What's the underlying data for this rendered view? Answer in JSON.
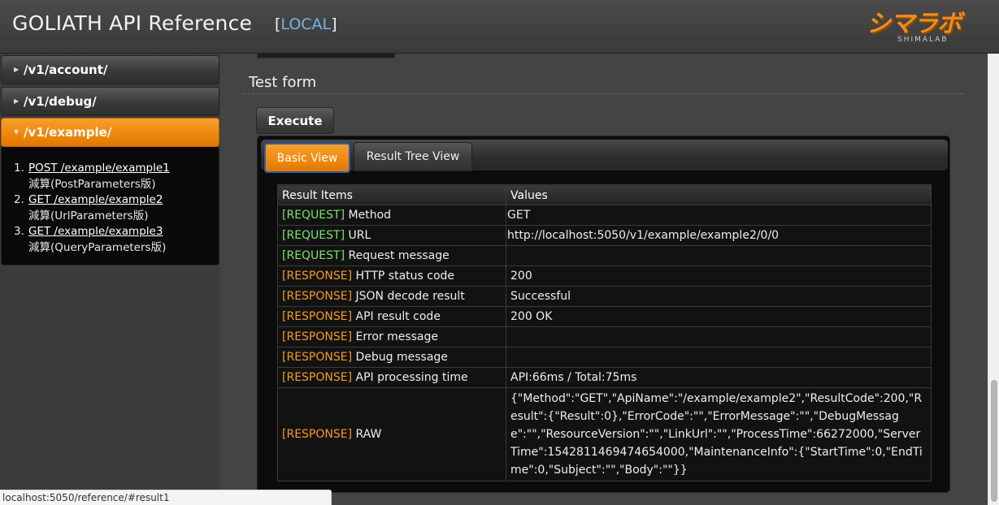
{
  "header": {
    "title": "GOLIATH API Reference",
    "env_open": "[",
    "env_name": "LOCAL",
    "env_close": "]",
    "logo_text": "シマラボ",
    "logo_sub": "SHIMALAB"
  },
  "sidebar": {
    "items": [
      {
        "label": "/v1/account/"
      },
      {
        "label": "/v1/debug/"
      },
      {
        "label": "/v1/example/"
      }
    ],
    "example_links": [
      {
        "num": "1.",
        "link": "POST /example/example1",
        "desc": "減算(PostParameters版)"
      },
      {
        "num": "2.",
        "link": "GET /example/example2",
        "desc": "減算(UrlParameters版)"
      },
      {
        "num": "3.",
        "link": "GET /example/example3",
        "desc": "減算(QueryParameters版)"
      }
    ]
  },
  "main": {
    "section_title": "Test form",
    "execute_label": "Execute",
    "tabs": [
      {
        "label": "Basic View"
      },
      {
        "label": "Result Tree View"
      }
    ],
    "table": {
      "headers": [
        "Result Items",
        "Values"
      ],
      "rows": [
        {
          "tag": "[REQUEST]",
          "item": " Method",
          "value": "GET"
        },
        {
          "tag": "[REQUEST]",
          "item": " URL",
          "value": "http://localhost:5050/v1/example/example2/0/0"
        },
        {
          "tag": "[REQUEST]",
          "item": " Request message",
          "value": ""
        },
        {
          "tag": "[RESPONSE]",
          "item": " HTTP status code",
          "value": "200"
        },
        {
          "tag": "[RESPONSE]",
          "item": " JSON decode result",
          "value": "Successful"
        },
        {
          "tag": "[RESPONSE]",
          "item": " API result code",
          "value": "200 OK"
        },
        {
          "tag": "[RESPONSE]",
          "item": " Error message",
          "value": ""
        },
        {
          "tag": "[RESPONSE]",
          "item": " Debug message",
          "value": ""
        },
        {
          "tag": "[RESPONSE]",
          "item": " API processing time",
          "value": "API:66ms / Total:75ms"
        },
        {
          "tag": "[RESPONSE]",
          "item": " RAW",
          "value": "{\"Method\":\"GET\",\"ApiName\":\"/example/example2\",\"ResultCode\":200,\"Result\":{\"Result\":0},\"ErrorCode\":\"\",\"ErrorMessage\":\"\",\"DebugMessage\":\"\",\"ResourceVersion\":\"\",\"LinkUrl\":\"\",\"ProcessTime\":66272000,\"ServerTime\":1542811469474654000,\"MaintenanceInfo\":{\"StartTime\":0,\"EndTime\":0,\"Subject\":\"\",\"Body\":\"\"}}"
        }
      ]
    }
  },
  "statusbar": {
    "url": "localhost:5050/reference/#result1"
  },
  "colors": {
    "accent_orange": "#f08a10",
    "request_tag": "#7ee06e",
    "response_tag": "#f79a22",
    "env_blue": "#6fb6e8"
  }
}
